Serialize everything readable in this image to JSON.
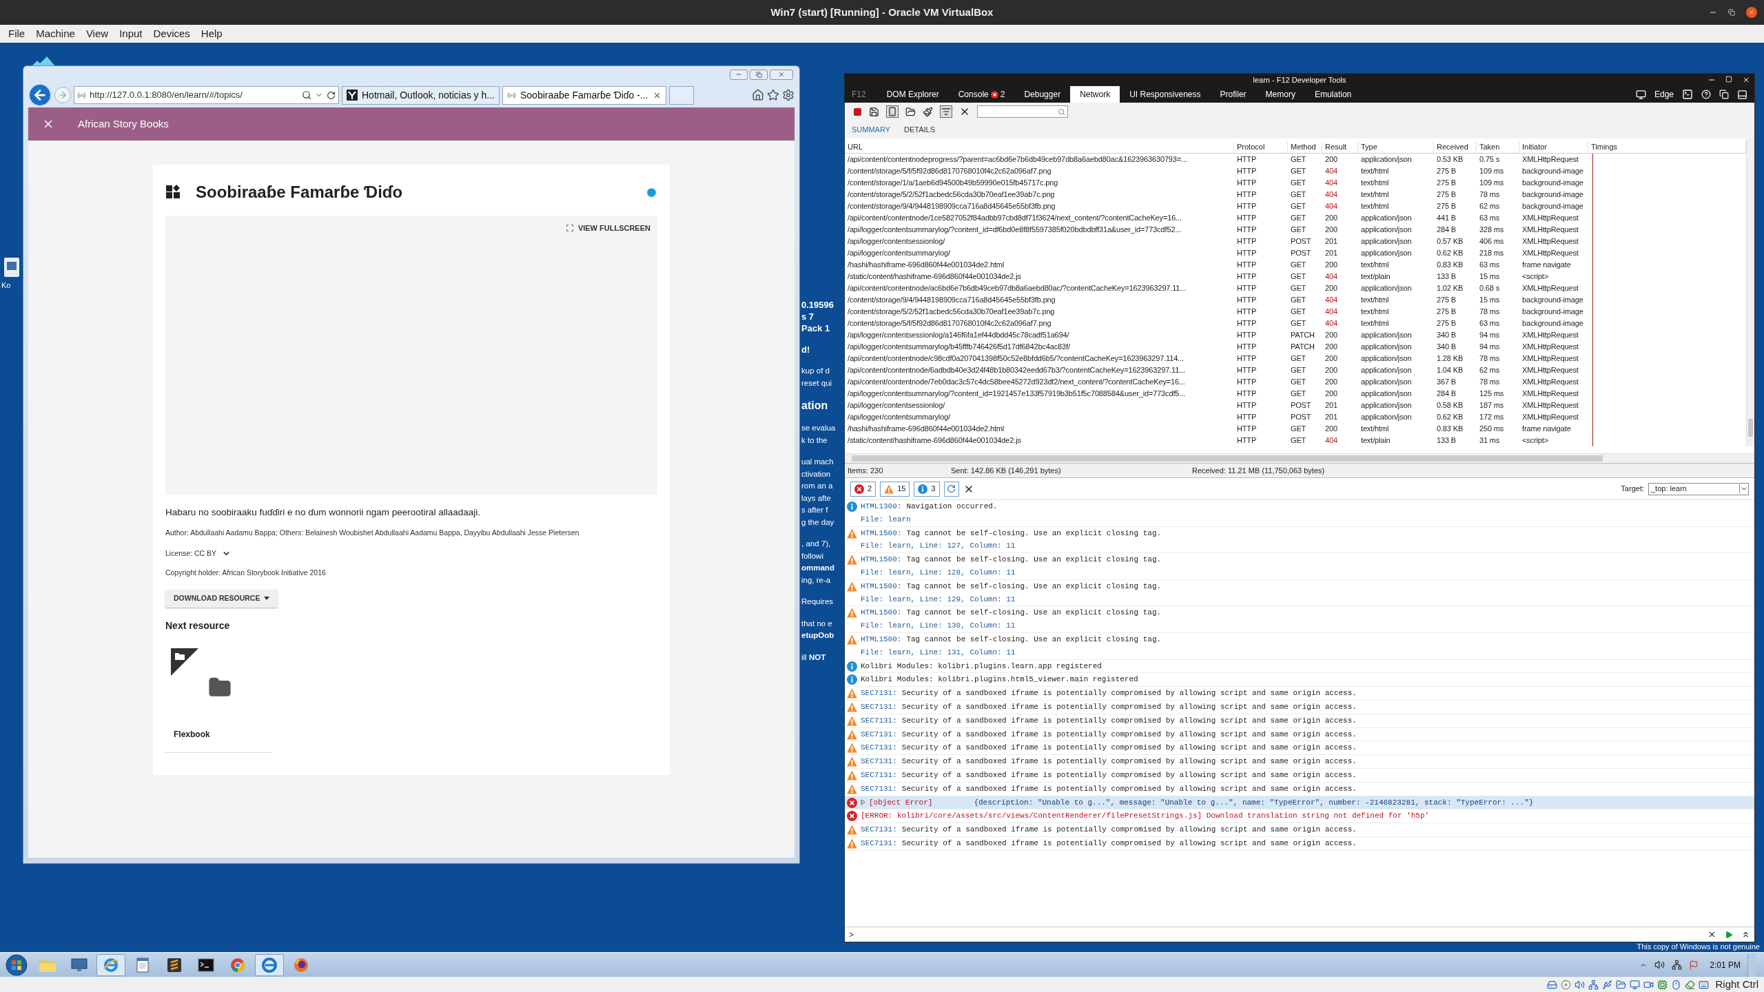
{
  "host_window": {
    "title": "Win7 (start) [Running] - Oracle VM VirtualBox"
  },
  "host_menu": [
    "File",
    "Machine",
    "View",
    "Input",
    "Devices",
    "Help"
  ],
  "desktop": {
    "icon_label": "Ko",
    "notice": "This copy of Windows is not genuine"
  },
  "browser": {
    "address": "http://127.0.0.1:8080/en/learn/#/topics/",
    "tabs": [
      {
        "title": "Hotmail, Outlook, noticias y h...",
        "selected": false
      },
      {
        "title": "Soobiraaɓe Famarɓe Ɗiɗo -...",
        "selected": true
      }
    ],
    "app_bar": {
      "title": "African Story Books"
    },
    "content": {
      "title": "Soobiraaɓe Famarɓe Ɗiɗo",
      "fullscreen": "VIEW FULLSCREEN",
      "description": "Habaru no soobiraaku fuɗɗiri e no ɗum wonnorii ngam peerootiral allaadaaji.",
      "author": "Author: Abdullaahi Aadamu Bappa; Others: Belainesh Woubishet Abdullaahi Aadamu Bappa, Dayyibu Abdullaahi Jesse Pietersen",
      "license": "License: CC BY",
      "copyright": "Copyright holder: African Storybook Initiative 2016",
      "download": "DOWNLOAD RESOURCE",
      "next_heading": "Next resource",
      "next_card": {
        "title": "Flexbook"
      }
    }
  },
  "background_window": {
    "paragraphs": [
      {
        "kind": "heading",
        "lines": [
          "0.19596",
          "s 7",
          "Pack 1"
        ]
      },
      {
        "kind": "heading",
        "lines": [
          "d!"
        ]
      },
      {
        "kind": "body",
        "lines": [
          "kup of d",
          "reset qui"
        ]
      },
      {
        "kind": "title",
        "lines": [
          "ation"
        ]
      },
      {
        "kind": "body",
        "lines": [
          "se evalua",
          "k to the"
        ]
      },
      {
        "kind": "body",
        "lines": [
          "ual mach",
          "ctivation",
          "rom an a",
          "lays afte",
          "s after f",
          "g the day"
        ]
      },
      {
        "kind": "body",
        "lines": [
          ", and 7),",
          "followi",
          "**ommand**",
          "ing, re-a"
        ]
      },
      {
        "kind": "body",
        "lines": [
          "Requires"
        ]
      },
      {
        "kind": "body",
        "lines": [
          "that no e",
          "**etupOob**"
        ]
      },
      {
        "kind": "body",
        "lines": [
          "ill **NOT**"
        ]
      }
    ]
  },
  "devtools": {
    "title": "learn - F12 Developer Tools",
    "f12_label": "F12",
    "tabs": [
      {
        "label": "DOM Explorer",
        "selected": false
      },
      {
        "label": "Console",
        "selected": false,
        "badge": "2"
      },
      {
        "label": "Debugger",
        "selected": false
      },
      {
        "label": "Network",
        "selected": true
      },
      {
        "label": "UI Responsiveness",
        "selected": false
      },
      {
        "label": "Profiler",
        "selected": false
      },
      {
        "label": "Memory",
        "selected": false
      },
      {
        "label": "Emulation",
        "selected": false
      }
    ],
    "mode": "Edge",
    "subtabs": [
      {
        "label": "SUMMARY",
        "selected": true
      },
      {
        "label": "DETAILS",
        "selected": false
      }
    ],
    "network": {
      "columns": [
        "URL",
        "Protocol",
        "Method",
        "Result",
        "Type",
        "Received",
        "Taken",
        "Initiator",
        "Timings"
      ],
      "rows": [
        {
          "cells": [
            "/api/content/contentnodeprogress/?parent=ac6bd6e7b6db49ceb97db8a6aebd80ac&1623963630793=...",
            "HTTP",
            "GET",
            "200",
            "application/json",
            "0.53 KB",
            "0.75 s",
            "XMLHttpRequest"
          ],
          "failed": false
        },
        {
          "cells": [
            "/content/storage/5/f/5f92d86d8170768010f4c2c62a096af7.png",
            "HTTP",
            "GET",
            "404",
            "text/html",
            "275 B",
            "109 ms",
            "background-image"
          ],
          "failed": true
        },
        {
          "cells": [
            "/content/storage/1/a/1aeb6d94500b49b59990e015fb45717c.png",
            "HTTP",
            "GET",
            "404",
            "text/html",
            "275 B",
            "109 ms",
            "background-image"
          ],
          "failed": true
        },
        {
          "cells": [
            "/content/storage/5/2/52f1acbedc56cda30b70eaf1ee39ab7c.png",
            "HTTP",
            "GET",
            "404",
            "text/html",
            "275 B",
            "78 ms",
            "background-image"
          ],
          "failed": true
        },
        {
          "cells": [
            "/content/storage/9/4/9448198909cca716a8d45645e55bf3fb.png",
            "HTTP",
            "GET",
            "404",
            "text/html",
            "275 B",
            "62 ms",
            "background-image"
          ],
          "failed": true
        },
        {
          "cells": [
            "/api/content/contentnode/1ce5827052f84adbb97cbd8df71f3624/next_content/?contentCacheKey=16...",
            "HTTP",
            "GET",
            "200",
            "application/json",
            "441 B",
            "63 ms",
            "XMLHttpRequest"
          ],
          "failed": false
        },
        {
          "cells": [
            "/api/logger/contentsummarylog/?content_id=df6bd0e8f8f5597385f020bdbdbff31a&user_id=773cdf52...",
            "HTTP",
            "GET",
            "200",
            "application/json",
            "284 B",
            "328 ms",
            "XMLHttpRequest"
          ],
          "failed": false
        },
        {
          "cells": [
            "/api/logger/contentsessionlog/",
            "HTTP",
            "POST",
            "201",
            "application/json",
            "0.57 KB",
            "406 ms",
            "XMLHttpRequest"
          ],
          "failed": false
        },
        {
          "cells": [
            "/api/logger/contentsummarylog/",
            "HTTP",
            "POST",
            "201",
            "application/json",
            "0.62 KB",
            "218 ms",
            "XMLHttpRequest"
          ],
          "failed": false
        },
        {
          "cells": [
            "/hashi/hashiframe-696d860f44e001034de2.html",
            "HTTP",
            "GET",
            "200",
            "text/html",
            "0.83 KB",
            "63 ms",
            "frame navigate"
          ],
          "failed": false
        },
        {
          "cells": [
            "/static/content/hashiframe-696d860f44e001034de2.js",
            "HTTP",
            "GET",
            "404",
            "text/plain",
            "133 B",
            "15 ms",
            "<script>"
          ],
          "failed": true
        },
        {
          "cells": [
            "/api/content/contentnode/ac6bd6e7b6db49ceb97db8a6aebd80ac/?contentCacheKey=1623963297.11...",
            "HTTP",
            "GET",
            "200",
            "application/json",
            "1.02 KB",
            "0.68 s",
            "XMLHttpRequest"
          ],
          "failed": false
        },
        {
          "cells": [
            "/content/storage/9/4/9448198909cca716a8d45645e55bf3fb.png",
            "HTTP",
            "GET",
            "404",
            "text/html",
            "275 B",
            "15 ms",
            "background-image"
          ],
          "failed": true
        },
        {
          "cells": [
            "/content/storage/5/2/52f1acbedc56cda30b70eaf1ee39ab7c.png",
            "HTTP",
            "GET",
            "404",
            "text/html",
            "275 B",
            "78 ms",
            "background-image"
          ],
          "failed": true
        },
        {
          "cells": [
            "/content/storage/5/f/5f92d86d8170768010f4c2c62a096af7.png",
            "HTTP",
            "GET",
            "404",
            "text/html",
            "275 B",
            "63 ms",
            "background-image"
          ],
          "failed": true
        },
        {
          "cells": [
            "/api/logger/contentsessionlog/a146f6fa1ef44dbdd45c78cadf51a694/",
            "HTTP",
            "PATCH",
            "200",
            "application/json",
            "340 B",
            "94 ms",
            "XMLHttpRequest"
          ],
          "failed": false
        },
        {
          "cells": [
            "/api/logger/contentsummarylog/b45fffb746426f5d17df6842bc4ac83f/",
            "HTTP",
            "PATCH",
            "200",
            "application/json",
            "340 B",
            "94 ms",
            "XMLHttpRequest"
          ],
          "failed": false
        },
        {
          "cells": [
            "/api/content/contentnode/c98cdf0a207041398f50c52e8bfdd6b5/?contentCacheKey=1623963297.114...",
            "HTTP",
            "GET",
            "200",
            "application/json",
            "1.28 KB",
            "78 ms",
            "XMLHttpRequest"
          ],
          "failed": false
        },
        {
          "cells": [
            "/api/content/contentnode/6adbdb40e3d24f48b1b80342eedd67b3/?contentCacheKey=1623963297.11...",
            "HTTP",
            "GET",
            "200",
            "application/json",
            "1.04 KB",
            "62 ms",
            "XMLHttpRequest"
          ],
          "failed": false
        },
        {
          "cells": [
            "/api/content/contentnode/7eb0dac3c57c4dc58bee45272d923df2/next_content/?contentCacheKey=16...",
            "HTTP",
            "GET",
            "200",
            "application/json",
            "367 B",
            "78 ms",
            "XMLHttpRequest"
          ],
          "failed": false
        },
        {
          "cells": [
            "/api/logger/contentsummarylog/?content_id=1921457e133f57919b3b51f5c7088584&user_id=773cdf5...",
            "HTTP",
            "GET",
            "200",
            "application/json",
            "284 B",
            "125 ms",
            "XMLHttpRequest"
          ],
          "failed": false
        },
        {
          "cells": [
            "/api/logger/contentsessionlog/",
            "HTTP",
            "POST",
            "201",
            "application/json",
            "0.58 KB",
            "187 ms",
            "XMLHttpRequest"
          ],
          "failed": false
        },
        {
          "cells": [
            "/api/logger/contentsummarylog/",
            "HTTP",
            "POST",
            "201",
            "application/json",
            "0.62 KB",
            "172 ms",
            "XMLHttpRequest"
          ],
          "failed": false
        },
        {
          "cells": [
            "/hashi/hashiframe-696d860f44e001034de2.html",
            "HTTP",
            "GET",
            "200",
            "text/html",
            "0.83 KB",
            "250 ms",
            "frame navigate"
          ],
          "failed": false
        },
        {
          "cells": [
            "/static/content/hashiframe-696d860f44e001034de2.js",
            "HTTP",
            "GET",
            "404",
            "text/plain",
            "133 B",
            "31 ms",
            "<script>"
          ],
          "failed": true
        }
      ]
    },
    "status": {
      "items": "Items: 230",
      "sent": "Sent: 142.86 KB (146,291 bytes)",
      "received": "Received: 11.21 MB (11,750,063 bytes)"
    },
    "console": {
      "filters": [
        {
          "kind": "error",
          "count": "2"
        },
        {
          "kind": "warning",
          "count": "15"
        },
        {
          "kind": "info",
          "count": "3"
        }
      ],
      "target_label": "Target:",
      "target": "_top: learn",
      "messages": [
        {
          "kind": "info",
          "code": "HTML1300:",
          "text": "Navigation occurred.",
          "file": "File: learn",
          "selected": false
        },
        {
          "kind": "warning",
          "code": "HTML1500:",
          "text": "Tag cannot be self-closing. Use an explicit closing tag.",
          "file": "File: learn, Line: 127, Column: 11",
          "selected": false
        },
        {
          "kind": "warning",
          "code": "HTML1500:",
          "text": "Tag cannot be self-closing. Use an explicit closing tag.",
          "file": "File: learn, Line: 128, Column: 11",
          "selected": false
        },
        {
          "kind": "warning",
          "code": "HTML1500:",
          "text": "Tag cannot be self-closing. Use an explicit closing tag.",
          "file": "File: learn, Line: 129, Column: 11",
          "selected": false
        },
        {
          "kind": "warning",
          "code": "HTML1500:",
          "text": "Tag cannot be self-closing. Use an explicit closing tag.",
          "file": "File: learn, Line: 130, Column: 11",
          "selected": false
        },
        {
          "kind": "warning",
          "code": "HTML1500:",
          "text": "Tag cannot be self-closing. Use an explicit closing tag.",
          "file": "File: learn, Line: 131, Column: 11",
          "selected": false
        },
        {
          "kind": "info",
          "text": "Kolibri Modules: kolibri.plugins.learn.app registered",
          "selected": false
        },
        {
          "kind": "info",
          "text": "Kolibri Modules: kolibri.plugins.html5_viewer.main registered",
          "selected": false
        },
        {
          "kind": "warning",
          "code": "SEC7131:",
          "text": "Security of a sandboxed iframe is potentially compromised by allowing script and same origin access.",
          "selected": false
        },
        {
          "kind": "warning",
          "code": "SEC7131:",
          "text": "Security of a sandboxed iframe is potentially compromised by allowing script and same origin access.",
          "selected": false
        },
        {
          "kind": "warning",
          "code": "SEC7131:",
          "text": "Security of a sandboxed iframe is potentially compromised by allowing script and same origin access.",
          "selected": false
        },
        {
          "kind": "warning",
          "code": "SEC7131:",
          "text": "Security of a sandboxed iframe is potentially compromised by allowing script and same origin access.",
          "selected": false
        },
        {
          "kind": "warning",
          "code": "SEC7131:",
          "text": "Security of a sandboxed iframe is potentially compromised by allowing script and same origin access.",
          "selected": false
        },
        {
          "kind": "warning",
          "code": "SEC7131:",
          "text": "Security of a sandboxed iframe is potentially compromised by allowing script and same origin access.",
          "selected": false
        },
        {
          "kind": "warning",
          "code": "SEC7131:",
          "text": "Security of a sandboxed iframe is potentially compromised by allowing script and same origin access.",
          "selected": false
        },
        {
          "kind": "warning",
          "code": "SEC7131:",
          "text": "Security of a sandboxed iframe is potentially compromised by allowing script and same origin access.",
          "selected": false
        },
        {
          "kind": "object",
          "code": "[object Error]",
          "text": "{description: \"Unable to g...\", message: \"Unable to g...\", name: \"TypeError\", number: -2146823281, stack: \"TypeError: ...\"}",
          "selected": true
        },
        {
          "kind": "error",
          "text": "[ERROR: kolibri/core/assets/src/views/ContentRenderer/filePresetStrings.js] Download translation string not defined for 'h5p'",
          "selected": false
        },
        {
          "kind": "warning",
          "code": "SEC7131:",
          "text": "Security of a sandboxed iframe is potentially compromised by allowing script and same origin access.",
          "selected": false
        },
        {
          "kind": "warning",
          "code": "SEC7131:",
          "text": "Security of a sandboxed iframe is potentially compromised by allowing script and same origin access.",
          "selected": false
        }
      ],
      "prompt": ">"
    }
  },
  "taskbar": {
    "apps": [
      {
        "kind": "explorer",
        "active": false
      },
      {
        "kind": "display",
        "active": false
      },
      {
        "kind": "ie",
        "active": true
      },
      {
        "kind": "notepad",
        "active": false
      },
      {
        "kind": "sublime",
        "active": false
      },
      {
        "kind": "cmd",
        "active": false
      },
      {
        "kind": "chrome",
        "active": false
      },
      {
        "kind": "edge",
        "active": true
      },
      {
        "kind": "firefox",
        "active": false
      }
    ],
    "clock": "2:01 PM"
  },
  "host_status": {
    "host_key": "Right Ctrl"
  }
}
